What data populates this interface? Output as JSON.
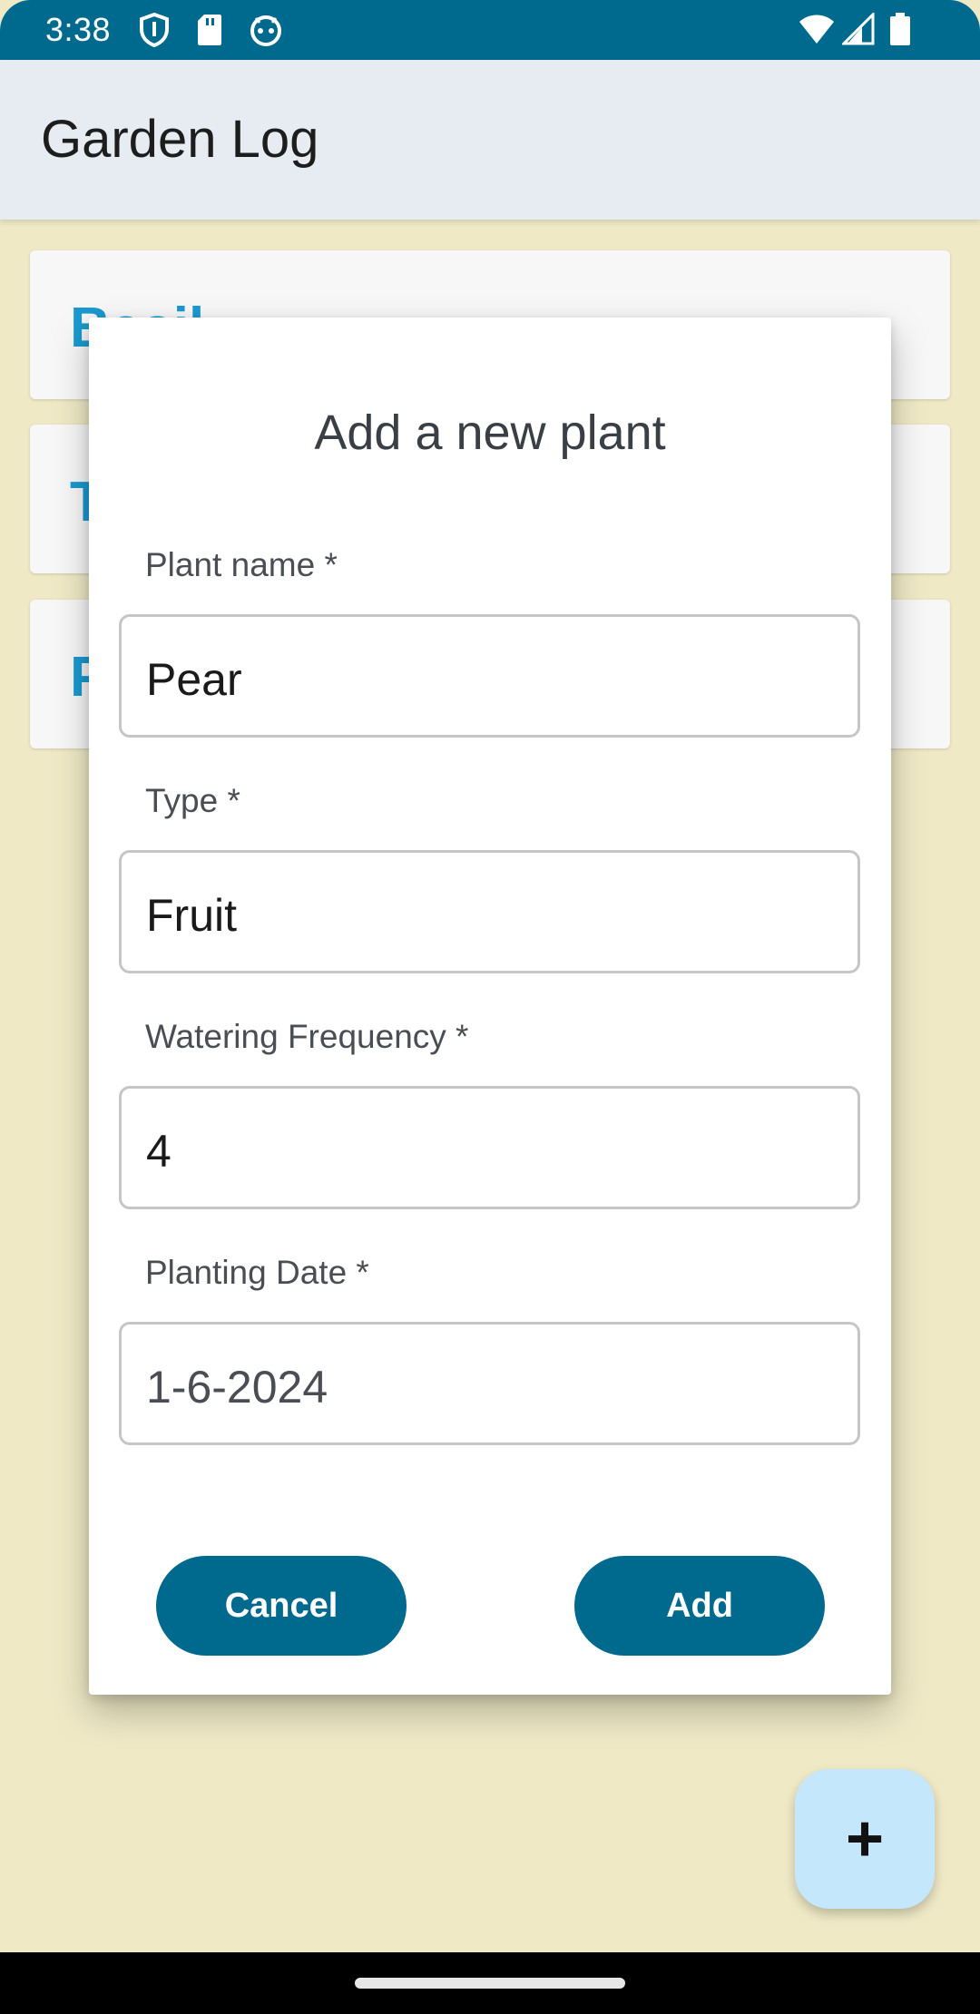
{
  "status_bar": {
    "time": "3:38",
    "icons_left": [
      "shield-icon",
      "sd-card-icon",
      "android-icon"
    ],
    "icons_right": [
      "wifi-icon",
      "signal-icon",
      "battery-icon"
    ]
  },
  "app_bar": {
    "title": "Garden Log"
  },
  "list": {
    "items": [
      {
        "label": "Basil"
      },
      {
        "label": "T"
      },
      {
        "label": "P"
      }
    ]
  },
  "dialog": {
    "title": "Add a new plant",
    "fields": [
      {
        "label": "Plant name *",
        "value": "Pear"
      },
      {
        "label": "Type *",
        "value": "Fruit"
      },
      {
        "label": "Watering Frequency *",
        "value": "4"
      },
      {
        "label": "Planting Date *",
        "value": "1-6-2024"
      }
    ],
    "cancel_label": "Cancel",
    "add_label": "Add"
  },
  "fab": {
    "label": "+",
    "icon": "plus-icon"
  },
  "colors": {
    "primary": "#006A8E",
    "background": "#EFE9C6",
    "app_bar": "#E6ECF2",
    "accent_text": "#1A9AD0",
    "fab": "#C5E7FB"
  }
}
